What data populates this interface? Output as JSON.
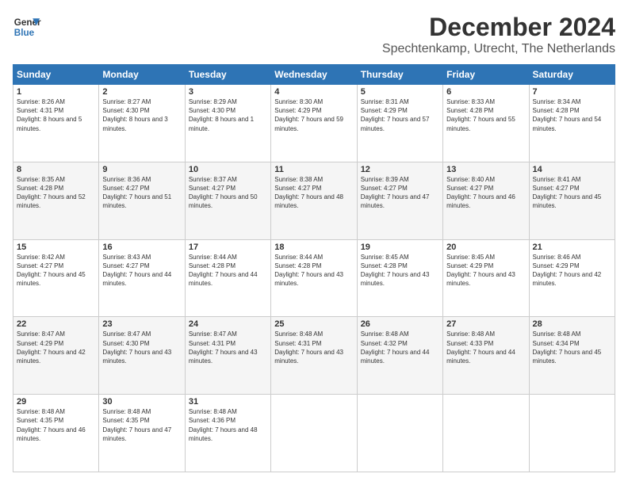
{
  "header": {
    "logo_line1": "General",
    "logo_line2": "Blue",
    "main_title": "December 2024",
    "subtitle": "Spechtenkamp, Utrecht, The Netherlands"
  },
  "days": [
    "Sunday",
    "Monday",
    "Tuesday",
    "Wednesday",
    "Thursday",
    "Friday",
    "Saturday"
  ],
  "weeks": [
    [
      {
        "num": "1",
        "sunrise": "Sunrise: 8:26 AM",
        "sunset": "Sunset: 4:31 PM",
        "daylight": "Daylight: 8 hours and 5 minutes."
      },
      {
        "num": "2",
        "sunrise": "Sunrise: 8:27 AM",
        "sunset": "Sunset: 4:30 PM",
        "daylight": "Daylight: 8 hours and 3 minutes."
      },
      {
        "num": "3",
        "sunrise": "Sunrise: 8:29 AM",
        "sunset": "Sunset: 4:30 PM",
        "daylight": "Daylight: 8 hours and 1 minute."
      },
      {
        "num": "4",
        "sunrise": "Sunrise: 8:30 AM",
        "sunset": "Sunset: 4:29 PM",
        "daylight": "Daylight: 7 hours and 59 minutes."
      },
      {
        "num": "5",
        "sunrise": "Sunrise: 8:31 AM",
        "sunset": "Sunset: 4:29 PM",
        "daylight": "Daylight: 7 hours and 57 minutes."
      },
      {
        "num": "6",
        "sunrise": "Sunrise: 8:33 AM",
        "sunset": "Sunset: 4:28 PM",
        "daylight": "Daylight: 7 hours and 55 minutes."
      },
      {
        "num": "7",
        "sunrise": "Sunrise: 8:34 AM",
        "sunset": "Sunset: 4:28 PM",
        "daylight": "Daylight: 7 hours and 54 minutes."
      }
    ],
    [
      {
        "num": "8",
        "sunrise": "Sunrise: 8:35 AM",
        "sunset": "Sunset: 4:28 PM",
        "daylight": "Daylight: 7 hours and 52 minutes."
      },
      {
        "num": "9",
        "sunrise": "Sunrise: 8:36 AM",
        "sunset": "Sunset: 4:27 PM",
        "daylight": "Daylight: 7 hours and 51 minutes."
      },
      {
        "num": "10",
        "sunrise": "Sunrise: 8:37 AM",
        "sunset": "Sunset: 4:27 PM",
        "daylight": "Daylight: 7 hours and 50 minutes."
      },
      {
        "num": "11",
        "sunrise": "Sunrise: 8:38 AM",
        "sunset": "Sunset: 4:27 PM",
        "daylight": "Daylight: 7 hours and 48 minutes."
      },
      {
        "num": "12",
        "sunrise": "Sunrise: 8:39 AM",
        "sunset": "Sunset: 4:27 PM",
        "daylight": "Daylight: 7 hours and 47 minutes."
      },
      {
        "num": "13",
        "sunrise": "Sunrise: 8:40 AM",
        "sunset": "Sunset: 4:27 PM",
        "daylight": "Daylight: 7 hours and 46 minutes."
      },
      {
        "num": "14",
        "sunrise": "Sunrise: 8:41 AM",
        "sunset": "Sunset: 4:27 PM",
        "daylight": "Daylight: 7 hours and 45 minutes."
      }
    ],
    [
      {
        "num": "15",
        "sunrise": "Sunrise: 8:42 AM",
        "sunset": "Sunset: 4:27 PM",
        "daylight": "Daylight: 7 hours and 45 minutes."
      },
      {
        "num": "16",
        "sunrise": "Sunrise: 8:43 AM",
        "sunset": "Sunset: 4:27 PM",
        "daylight": "Daylight: 7 hours and 44 minutes."
      },
      {
        "num": "17",
        "sunrise": "Sunrise: 8:44 AM",
        "sunset": "Sunset: 4:28 PM",
        "daylight": "Daylight: 7 hours and 44 minutes."
      },
      {
        "num": "18",
        "sunrise": "Sunrise: 8:44 AM",
        "sunset": "Sunset: 4:28 PM",
        "daylight": "Daylight: 7 hours and 43 minutes."
      },
      {
        "num": "19",
        "sunrise": "Sunrise: 8:45 AM",
        "sunset": "Sunset: 4:28 PM",
        "daylight": "Daylight: 7 hours and 43 minutes."
      },
      {
        "num": "20",
        "sunrise": "Sunrise: 8:45 AM",
        "sunset": "Sunset: 4:29 PM",
        "daylight": "Daylight: 7 hours and 43 minutes."
      },
      {
        "num": "21",
        "sunrise": "Sunrise: 8:46 AM",
        "sunset": "Sunset: 4:29 PM",
        "daylight": "Daylight: 7 hours and 42 minutes."
      }
    ],
    [
      {
        "num": "22",
        "sunrise": "Sunrise: 8:47 AM",
        "sunset": "Sunset: 4:29 PM",
        "daylight": "Daylight: 7 hours and 42 minutes."
      },
      {
        "num": "23",
        "sunrise": "Sunrise: 8:47 AM",
        "sunset": "Sunset: 4:30 PM",
        "daylight": "Daylight: 7 hours and 43 minutes."
      },
      {
        "num": "24",
        "sunrise": "Sunrise: 8:47 AM",
        "sunset": "Sunset: 4:31 PM",
        "daylight": "Daylight: 7 hours and 43 minutes."
      },
      {
        "num": "25",
        "sunrise": "Sunrise: 8:48 AM",
        "sunset": "Sunset: 4:31 PM",
        "daylight": "Daylight: 7 hours and 43 minutes."
      },
      {
        "num": "26",
        "sunrise": "Sunrise: 8:48 AM",
        "sunset": "Sunset: 4:32 PM",
        "daylight": "Daylight: 7 hours and 44 minutes."
      },
      {
        "num": "27",
        "sunrise": "Sunrise: 8:48 AM",
        "sunset": "Sunset: 4:33 PM",
        "daylight": "Daylight: 7 hours and 44 minutes."
      },
      {
        "num": "28",
        "sunrise": "Sunrise: 8:48 AM",
        "sunset": "Sunset: 4:34 PM",
        "daylight": "Daylight: 7 hours and 45 minutes."
      }
    ],
    [
      {
        "num": "29",
        "sunrise": "Sunrise: 8:48 AM",
        "sunset": "Sunset: 4:35 PM",
        "daylight": "Daylight: 7 hours and 46 minutes."
      },
      {
        "num": "30",
        "sunrise": "Sunrise: 8:48 AM",
        "sunset": "Sunset: 4:35 PM",
        "daylight": "Daylight: 7 hours and 47 minutes."
      },
      {
        "num": "31",
        "sunrise": "Sunrise: 8:48 AM",
        "sunset": "Sunset: 4:36 PM",
        "daylight": "Daylight: 7 hours and 48 minutes."
      },
      null,
      null,
      null,
      null
    ]
  ]
}
